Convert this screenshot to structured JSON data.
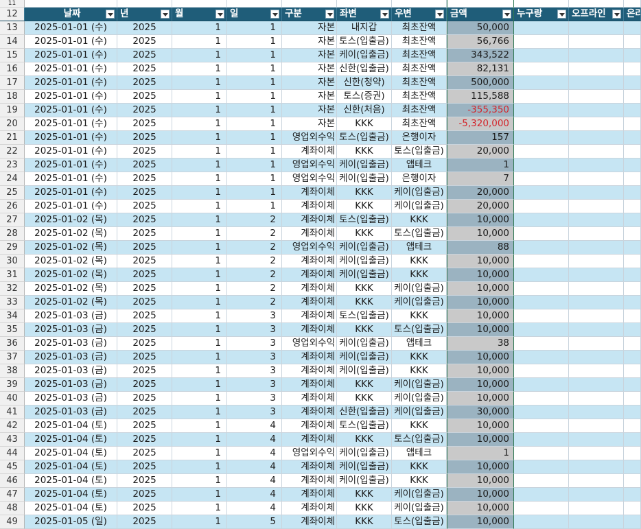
{
  "sheet": {
    "header_row_number": "12",
    "top_row_number": "11",
    "columns": [
      "날짜",
      "년",
      "월",
      "일",
      "구분",
      "좌변",
      "우변",
      "금액",
      "누구랑",
      "오프라인",
      "온라"
    ],
    "rows": [
      {
        "n": "13",
        "date": "2025-01-01 (수)",
        "year": "2025",
        "month": "1",
        "day": "1",
        "type": "자본",
        "left": "내지갑",
        "right": "최초잔액",
        "amount": "50,000",
        "neg": false
      },
      {
        "n": "14",
        "date": "2025-01-01 (수)",
        "year": "2025",
        "month": "1",
        "day": "1",
        "type": "자본",
        "left": "토스(입출금)",
        "right": "최초잔액",
        "amount": "56,766",
        "neg": false
      },
      {
        "n": "15",
        "date": "2025-01-01 (수)",
        "year": "2025",
        "month": "1",
        "day": "1",
        "type": "자본",
        "left": "케이(입출금)",
        "right": "최초잔액",
        "amount": "343,522",
        "neg": false
      },
      {
        "n": "16",
        "date": "2025-01-01 (수)",
        "year": "2025",
        "month": "1",
        "day": "1",
        "type": "자본",
        "left": "신한(입출금)",
        "right": "최초잔액",
        "amount": "82,131",
        "neg": false
      },
      {
        "n": "17",
        "date": "2025-01-01 (수)",
        "year": "2025",
        "month": "1",
        "day": "1",
        "type": "자본",
        "left": "신한(청약)",
        "right": "최초잔액",
        "amount": "500,000",
        "neg": false
      },
      {
        "n": "18",
        "date": "2025-01-01 (수)",
        "year": "2025",
        "month": "1",
        "day": "1",
        "type": "자본",
        "left": "토스(증권)",
        "right": "최초잔액",
        "amount": "115,588",
        "neg": false
      },
      {
        "n": "19",
        "date": "2025-01-01 (수)",
        "year": "2025",
        "month": "1",
        "day": "1",
        "type": "자본",
        "left": "신한(처음)",
        "right": "최초잔액",
        "amount": "-355,350",
        "neg": true
      },
      {
        "n": "20",
        "date": "2025-01-01 (수)",
        "year": "2025",
        "month": "1",
        "day": "1",
        "type": "자본",
        "left": "KKK",
        "right": "최초잔액",
        "amount": "-5,320,000",
        "neg": true
      },
      {
        "n": "21",
        "date": "2025-01-01 (수)",
        "year": "2025",
        "month": "1",
        "day": "1",
        "type": "영업외수익",
        "left": "토스(입출금)",
        "right": "은행이자",
        "amount": "157",
        "neg": false
      },
      {
        "n": "22",
        "date": "2025-01-01 (수)",
        "year": "2025",
        "month": "1",
        "day": "1",
        "type": "계좌이체",
        "left": "KKK",
        "right": "토스(입출금)",
        "amount": "20,000",
        "neg": false
      },
      {
        "n": "23",
        "date": "2025-01-01 (수)",
        "year": "2025",
        "month": "1",
        "day": "1",
        "type": "영업외수익",
        "left": "케이(입출금)",
        "right": "앱테크",
        "amount": "1",
        "neg": false
      },
      {
        "n": "24",
        "date": "2025-01-01 (수)",
        "year": "2025",
        "month": "1",
        "day": "1",
        "type": "영업외수익",
        "left": "케이(입출금)",
        "right": "은행이자",
        "amount": "7",
        "neg": false
      },
      {
        "n": "25",
        "date": "2025-01-01 (수)",
        "year": "2025",
        "month": "1",
        "day": "1",
        "type": "계좌이체",
        "left": "KKK",
        "right": "케이(입출금)",
        "amount": "20,000",
        "neg": false
      },
      {
        "n": "26",
        "date": "2025-01-01 (수)",
        "year": "2025",
        "month": "1",
        "day": "1",
        "type": "계좌이체",
        "left": "KKK",
        "right": "케이(입출금)",
        "amount": "20,000",
        "neg": false
      },
      {
        "n": "27",
        "date": "2025-01-02 (목)",
        "year": "2025",
        "month": "1",
        "day": "2",
        "type": "계좌이체",
        "left": "토스(입출금)",
        "right": "KKK",
        "amount": "10,000",
        "neg": false
      },
      {
        "n": "28",
        "date": "2025-01-02 (목)",
        "year": "2025",
        "month": "1",
        "day": "2",
        "type": "계좌이체",
        "left": "KKK",
        "right": "토스(입출금)",
        "amount": "10,000",
        "neg": false
      },
      {
        "n": "29",
        "date": "2025-01-02 (목)",
        "year": "2025",
        "month": "1",
        "day": "2",
        "type": "영업외수익",
        "left": "케이(입출금)",
        "right": "앱테크",
        "amount": "88",
        "neg": false
      },
      {
        "n": "30",
        "date": "2025-01-02 (목)",
        "year": "2025",
        "month": "1",
        "day": "2",
        "type": "계좌이체",
        "left": "케이(입출금)",
        "right": "KKK",
        "amount": "10,000",
        "neg": false
      },
      {
        "n": "31",
        "date": "2025-01-02 (목)",
        "year": "2025",
        "month": "1",
        "day": "2",
        "type": "계좌이체",
        "left": "케이(입출금)",
        "right": "KKK",
        "amount": "10,000",
        "neg": false
      },
      {
        "n": "32",
        "date": "2025-01-02 (목)",
        "year": "2025",
        "month": "1",
        "day": "2",
        "type": "계좌이체",
        "left": "KKK",
        "right": "케이(입출금)",
        "amount": "10,000",
        "neg": false
      },
      {
        "n": "33",
        "date": "2025-01-02 (목)",
        "year": "2025",
        "month": "1",
        "day": "2",
        "type": "계좌이체",
        "left": "KKK",
        "right": "케이(입출금)",
        "amount": "10,000",
        "neg": false
      },
      {
        "n": "34",
        "date": "2025-01-03 (금)",
        "year": "2025",
        "month": "1",
        "day": "3",
        "type": "계좌이체",
        "left": "토스(입출금)",
        "right": "KKK",
        "amount": "10,000",
        "neg": false
      },
      {
        "n": "35",
        "date": "2025-01-03 (금)",
        "year": "2025",
        "month": "1",
        "day": "3",
        "type": "계좌이체",
        "left": "KKK",
        "right": "토스(입출금)",
        "amount": "10,000",
        "neg": false
      },
      {
        "n": "36",
        "date": "2025-01-03 (금)",
        "year": "2025",
        "month": "1",
        "day": "3",
        "type": "영업외수익",
        "left": "케이(입출금)",
        "right": "앱테크",
        "amount": "38",
        "neg": false
      },
      {
        "n": "37",
        "date": "2025-01-03 (금)",
        "year": "2025",
        "month": "1",
        "day": "3",
        "type": "계좌이체",
        "left": "케이(입출금)",
        "right": "KKK",
        "amount": "10,000",
        "neg": false
      },
      {
        "n": "38",
        "date": "2025-01-03 (금)",
        "year": "2025",
        "month": "1",
        "day": "3",
        "type": "계좌이체",
        "left": "케이(입출금)",
        "right": "KKK",
        "amount": "10,000",
        "neg": false
      },
      {
        "n": "39",
        "date": "2025-01-03 (금)",
        "year": "2025",
        "month": "1",
        "day": "3",
        "type": "계좌이체",
        "left": "KKK",
        "right": "케이(입출금)",
        "amount": "10,000",
        "neg": false
      },
      {
        "n": "40",
        "date": "2025-01-03 (금)",
        "year": "2025",
        "month": "1",
        "day": "3",
        "type": "계좌이체",
        "left": "KKK",
        "right": "케이(입출금)",
        "amount": "10,000",
        "neg": false
      },
      {
        "n": "41",
        "date": "2025-01-03 (금)",
        "year": "2025",
        "month": "1",
        "day": "3",
        "type": "계좌이체",
        "left": "신한(입출금)",
        "right": "케이(입출금)",
        "amount": "30,000",
        "neg": false
      },
      {
        "n": "42",
        "date": "2025-01-04 (토)",
        "year": "2025",
        "month": "1",
        "day": "4",
        "type": "계좌이체",
        "left": "토스(입출금)",
        "right": "KKK",
        "amount": "10,000",
        "neg": false
      },
      {
        "n": "43",
        "date": "2025-01-04 (토)",
        "year": "2025",
        "month": "1",
        "day": "4",
        "type": "계좌이체",
        "left": "KKK",
        "right": "토스(입출금)",
        "amount": "10,000",
        "neg": false
      },
      {
        "n": "44",
        "date": "2025-01-04 (토)",
        "year": "2025",
        "month": "1",
        "day": "4",
        "type": "영업외수익",
        "left": "케이(입출금)",
        "right": "앱테크",
        "amount": "1",
        "neg": false
      },
      {
        "n": "45",
        "date": "2025-01-04 (토)",
        "year": "2025",
        "month": "1",
        "day": "4",
        "type": "계좌이체",
        "left": "케이(입출금)",
        "right": "KKK",
        "amount": "10,000",
        "neg": false
      },
      {
        "n": "46",
        "date": "2025-01-04 (토)",
        "year": "2025",
        "month": "1",
        "day": "4",
        "type": "계좌이체",
        "left": "케이(입출금)",
        "right": "KKK",
        "amount": "10,000",
        "neg": false
      },
      {
        "n": "47",
        "date": "2025-01-04 (토)",
        "year": "2025",
        "month": "1",
        "day": "4",
        "type": "계좌이체",
        "left": "KKK",
        "right": "케이(입출금)",
        "amount": "10,000",
        "neg": false
      },
      {
        "n": "48",
        "date": "2025-01-04 (토)",
        "year": "2025",
        "month": "1",
        "day": "4",
        "type": "계좌이체",
        "left": "KKK",
        "right": "케이(입출금)",
        "amount": "10,000",
        "neg": false
      },
      {
        "n": "49",
        "date": "2025-01-05 (일)",
        "year": "2025",
        "month": "1",
        "day": "5",
        "type": "계좌이체",
        "left": "KKK",
        "right": "토스(입출금)",
        "amount": "10,000",
        "neg": false
      }
    ]
  },
  "colors": {
    "header_bg": "#1f5d79",
    "band_a": "#c6e5f3",
    "band_b": "#ffffff",
    "amount_a": "#9bb3c1",
    "amount_b": "#c9c9c9",
    "negative": "#d3252b"
  },
  "icons": {
    "filter": "dropdown-filter-icon"
  }
}
